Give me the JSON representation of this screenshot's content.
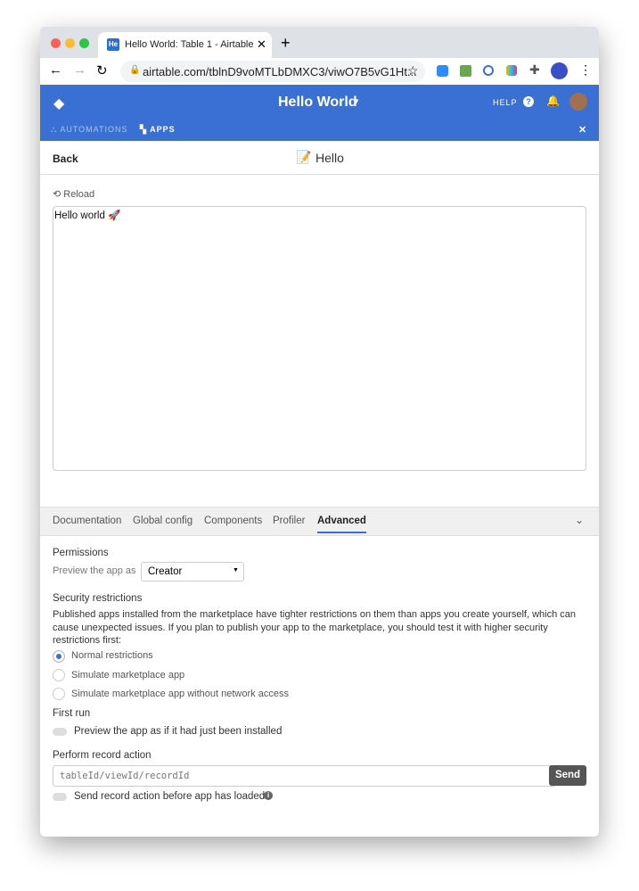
{
  "browser": {
    "tab_title": "Hello World: Table 1 - Airtable",
    "favicon": "He",
    "url": "airtable.com/tblnD9voMTLbDMXC3/viwO7B5vG1Ht..."
  },
  "header": {
    "base_name": "Hello World",
    "help": "HELP",
    "automations": "AUTOMATIONS",
    "apps": "APPS",
    "accent": "#3a70d3"
  },
  "app": {
    "back": "Back",
    "title": "Hello",
    "reload": "Reload",
    "output": "Hello world 🚀"
  },
  "devtools": {
    "tabs": [
      "Documentation",
      "Global config",
      "Components",
      "Profiler",
      "Advanced"
    ],
    "active_tab": "Advanced",
    "permissions": {
      "heading": "Permissions",
      "label": "Preview the app as",
      "value": "Creator"
    },
    "security": {
      "heading": "Security restrictions",
      "description": "Published apps installed from the marketplace have tighter restrictions on them than apps you create yourself, which can cause unexpected issues. If you plan to publish your app to the marketplace, you should test it with higher security restrictions first:",
      "options": [
        "Normal restrictions",
        "Simulate marketplace app",
        "Simulate marketplace app without network access"
      ],
      "selected": "Normal restrictions"
    },
    "first_run": {
      "heading": "First run",
      "toggle": "Preview the app as if it had just been installed"
    },
    "record_action": {
      "heading": "Perform record action",
      "placeholder": "tableId/viewId/recordId",
      "send": "Send",
      "toggle": "Send record action before app has loaded"
    }
  }
}
